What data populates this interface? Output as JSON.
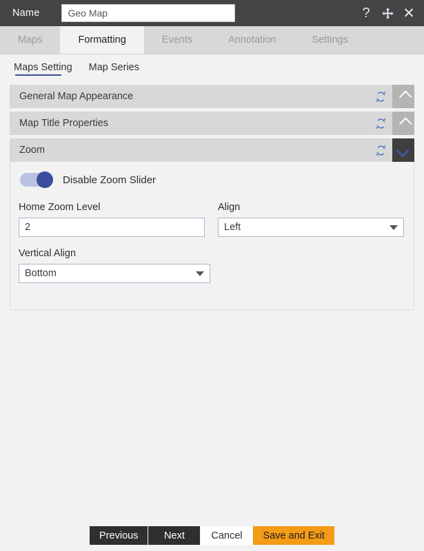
{
  "titlebar": {
    "name_label": "Name",
    "name_value": "Geo Map",
    "name_placeholder": "Name",
    "help_icon": "question-mark-icon",
    "move_icon": "move-arrows-icon",
    "close_icon": "close-x-icon"
  },
  "tabs": [
    {
      "label": "Maps",
      "active": false
    },
    {
      "label": "Formatting",
      "active": true
    },
    {
      "label": "Events",
      "active": false
    },
    {
      "label": "Annotation",
      "active": false
    },
    {
      "label": "Settings",
      "active": false
    }
  ],
  "subtabs": [
    {
      "label": "Maps Setting",
      "active": true
    },
    {
      "label": "Map Series",
      "active": false
    }
  ],
  "accordions": [
    {
      "title": "General Map Appearance",
      "expanded": false
    },
    {
      "title": "Map Title Properties",
      "expanded": false
    },
    {
      "title": "Zoom",
      "expanded": true
    }
  ],
  "zoom_panel": {
    "toggle": {
      "label": "Disable Zoom Slider",
      "on": true
    },
    "home_zoom_level": {
      "label": "Home Zoom Level",
      "value": "2"
    },
    "align": {
      "label": "Align",
      "value": "Left"
    },
    "vertical_align": {
      "label": "Vertical Align",
      "value": "Bottom"
    }
  },
  "footer": {
    "previous": "Previous",
    "next": "Next",
    "cancel": "Cancel",
    "save_and_exit": "Save and Exit"
  },
  "colors": {
    "titlebar": "#444444",
    "accent_orange": "#f59b17",
    "accent_blue": "#3a4d9e",
    "tab_inactive_bg": "#d8d8d8",
    "panel_bg": "#f2f2f2"
  }
}
